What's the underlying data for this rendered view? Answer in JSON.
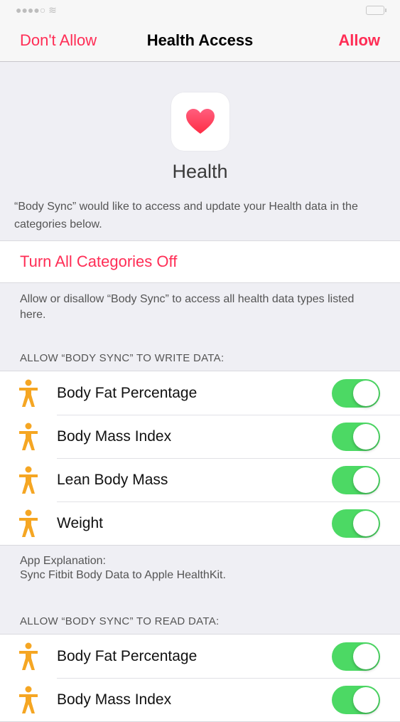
{
  "nav": {
    "left_label": "Don't Allow",
    "title": "Health Access",
    "right_label": "Allow"
  },
  "app": {
    "name": "Health"
  },
  "description": "“Body Sync” would like to access and update your Health data in the categories below.",
  "turn_all_off_label": "Turn All Categories Off",
  "turn_all_note": "Allow or disallow “Body Sync” to access all health data types listed here.",
  "write_section": {
    "header": "ALLOW “BODY SYNC” TO WRITE DATA:",
    "items": [
      {
        "label": "Body Fat Percentage",
        "on": true
      },
      {
        "label": "Body Mass Index",
        "on": true
      },
      {
        "label": "Lean Body Mass",
        "on": true
      },
      {
        "label": "Weight",
        "on": true
      }
    ]
  },
  "explanation": {
    "title": "App Explanation:",
    "text": "Sync Fitbit Body Data to Apple HealthKit."
  },
  "read_section": {
    "header": "ALLOW “BODY SYNC” TO READ DATA:",
    "items": [
      {
        "label": "Body Fat Percentage",
        "on": true
      },
      {
        "label": "Body Mass Index",
        "on": true
      }
    ]
  },
  "colors": {
    "accent": "#ff2d55",
    "toggle_on": "#4cd964",
    "person_icon": "#f5a623",
    "heart": "#ff3b5c"
  },
  "icons": {
    "app": "heart-icon",
    "category": "person-icon"
  }
}
